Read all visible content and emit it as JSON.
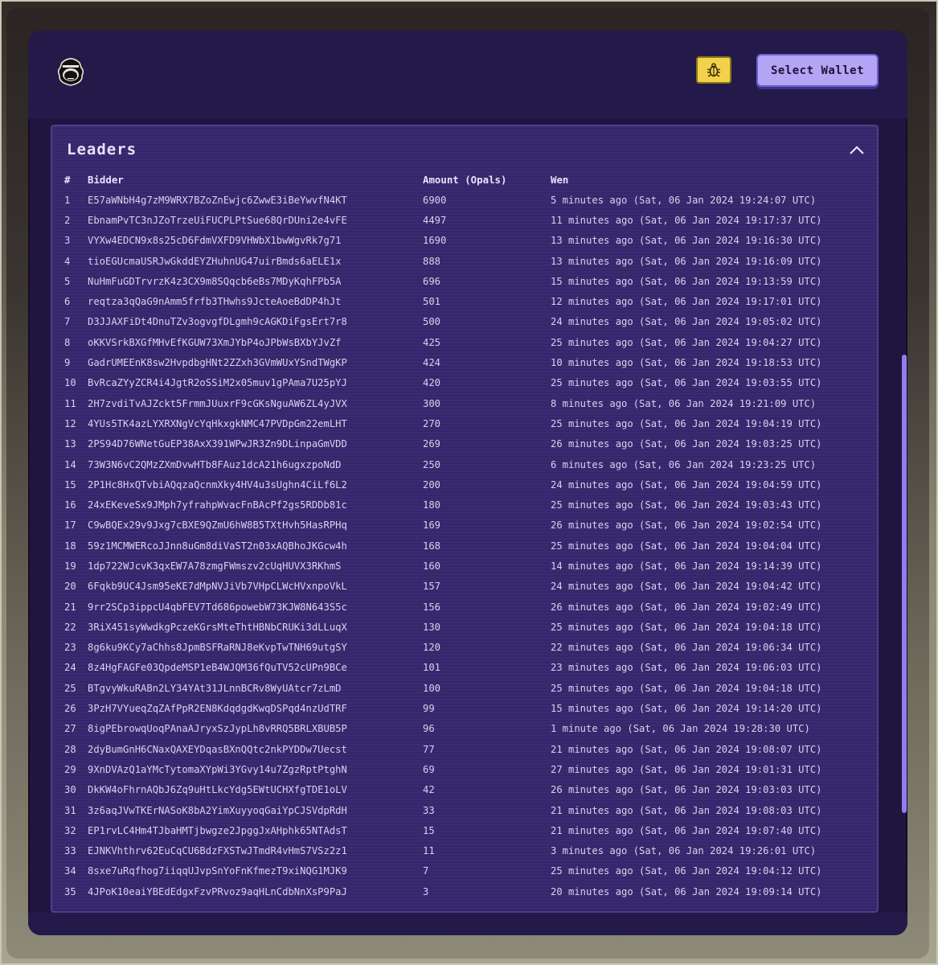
{
  "header": {
    "logo_icon": "gorilla-logo-icon",
    "bug_icon": "bug-icon",
    "wallet_label": "Select Wallet"
  },
  "colors": {
    "background": "#1f1640",
    "panel": "#3b2a72",
    "accent": "#b3a4f5",
    "bug_button": "#f2d24a"
  },
  "leaders": {
    "title": "Leaders",
    "collapse_icon": "chevron-up-icon",
    "columns": [
      "#",
      "Bidder",
      "Amount (Opals)",
      "Wen"
    ],
    "rows": [
      {
        "rank": "1",
        "bidder": "E57aWNbH4g7zM9WRX7BZoZnEwjc6ZwwE3iBeYwvfN4KT",
        "amount": "6900",
        "wen": "5 minutes ago (Sat, 06 Jan 2024 19:24:07 UTC)"
      },
      {
        "rank": "2",
        "bidder": "EbnamPvTC3nJZoTrzeUiFUCPLPtSue68QrDUni2e4vFE",
        "amount": "4497",
        "wen": "11 minutes ago (Sat, 06 Jan 2024 19:17:37 UTC)"
      },
      {
        "rank": "3",
        "bidder": "VYXw4EDCN9x8s25cD6FdmVXFD9VHWbX1bwWgvRk7g71",
        "amount": "1690",
        "wen": "13 minutes ago (Sat, 06 Jan 2024 19:16:30 UTC)"
      },
      {
        "rank": "4",
        "bidder": "tioEGUcmaUSRJwGkddEYZHuhnUG47uirBmds6aELE1x",
        "amount": "888",
        "wen": "13 minutes ago (Sat, 06 Jan 2024 19:16:09 UTC)"
      },
      {
        "rank": "5",
        "bidder": "NuHmFuGDTrvrzK4z3CX9m8SQqcb6eBs7MDyKqhFPb5A",
        "amount": "696",
        "wen": "15 minutes ago (Sat, 06 Jan 2024 19:13:59 UTC)"
      },
      {
        "rank": "6",
        "bidder": "reqtza3qQaG9nAmm5frfb3THwhs9JcteAoeBdDP4hJt",
        "amount": "501",
        "wen": "12 minutes ago (Sat, 06 Jan 2024 19:17:01 UTC)"
      },
      {
        "rank": "7",
        "bidder": "D3JJAXFiDt4DnuTZv3ogvgfDLgmh9cAGKDiFgsErt7r8",
        "amount": "500",
        "wen": "24 minutes ago (Sat, 06 Jan 2024 19:05:02 UTC)"
      },
      {
        "rank": "8",
        "bidder": "oKKVSrkBXGfMHvEfKGUW73XmJYbP4oJPbWsBXbYJvZf",
        "amount": "425",
        "wen": "25 minutes ago (Sat, 06 Jan 2024 19:04:27 UTC)"
      },
      {
        "rank": "9",
        "bidder": "GadrUMEEnK8sw2HvpdbgHNt2ZZxh3GVmWUxYSndTWgKP",
        "amount": "424",
        "wen": "10 minutes ago (Sat, 06 Jan 2024 19:18:53 UTC)"
      },
      {
        "rank": "10",
        "bidder": "BvRcaZYyZCR4i4JgtR2oSSiM2x05muv1gPAma7U25pYJ",
        "amount": "420",
        "wen": "25 minutes ago (Sat, 06 Jan 2024 19:03:55 UTC)"
      },
      {
        "rank": "11",
        "bidder": "2H7zvdiTvAJZckt5FrmmJUuxrF9cGKsNguAW6ZL4yJVX",
        "amount": "300",
        "wen": "8 minutes ago (Sat, 06 Jan 2024 19:21:09 UTC)"
      },
      {
        "rank": "12",
        "bidder": "4YUs5TK4azLYXRXNgVcYqHkxgkNMC47PVDpGm22emLHT",
        "amount": "270",
        "wen": "25 minutes ago (Sat, 06 Jan 2024 19:04:19 UTC)"
      },
      {
        "rank": "13",
        "bidder": "2PS94D76WNetGuEP38AxX391WPwJR3Zn9DLinpaGmVDD",
        "amount": "269",
        "wen": "26 minutes ago (Sat, 06 Jan 2024 19:03:25 UTC)"
      },
      {
        "rank": "14",
        "bidder": "73W3N6vC2QMzZXmDvwHTb8FAuz1dcA21h6ugxzpoNdD",
        "amount": "250",
        "wen": "6 minutes ago (Sat, 06 Jan 2024 19:23:25 UTC)"
      },
      {
        "rank": "15",
        "bidder": "2P1Hc8HxQTvbiAQqzaQcnmXky4HV4u3sUghn4CiLf6L2",
        "amount": "200",
        "wen": "24 minutes ago (Sat, 06 Jan 2024 19:04:59 UTC)"
      },
      {
        "rank": "16",
        "bidder": "24xEKeveSx9JMph7yfrahpWvacFnBAcPf2gs5RDDb81c",
        "amount": "180",
        "wen": "25 minutes ago (Sat, 06 Jan 2024 19:03:43 UTC)"
      },
      {
        "rank": "17",
        "bidder": "C9wBQEx29v9Jxg7cBXE9QZmU6hW8B5TXtHvh5HasRPHq",
        "amount": "169",
        "wen": "26 minutes ago (Sat, 06 Jan 2024 19:02:54 UTC)"
      },
      {
        "rank": "18",
        "bidder": "59z1MCMWERcoJJnn8uGm8diVaST2n03xAQBhoJKGcw4h",
        "amount": "168",
        "wen": "25 minutes ago (Sat, 06 Jan 2024 19:04:04 UTC)"
      },
      {
        "rank": "19",
        "bidder": "1dp722WJcvK3qxEW7A78zmgFWmszv2cUqHUVX3RKhmS",
        "amount": "160",
        "wen": "14 minutes ago (Sat, 06 Jan 2024 19:14:39 UTC)"
      },
      {
        "rank": "20",
        "bidder": "6Fqkb9UC4Jsm95eKE7dMpNVJiVb7VHpCLWcHVxnpoVkL",
        "amount": "157",
        "wen": "24 minutes ago (Sat, 06 Jan 2024 19:04:42 UTC)"
      },
      {
        "rank": "21",
        "bidder": "9rr2SCp3ippcU4qbFEV7Td686powebW73KJW8N643S5c",
        "amount": "156",
        "wen": "26 minutes ago (Sat, 06 Jan 2024 19:02:49 UTC)"
      },
      {
        "rank": "22",
        "bidder": "3RiX451syWwdkgPczeKGrsMteThtHBNbCRUKi3dLLuqX",
        "amount": "130",
        "wen": "25 minutes ago (Sat, 06 Jan 2024 19:04:18 UTC)"
      },
      {
        "rank": "23",
        "bidder": "8g6ku9KCy7aChhs8JpmBSFRaRNJ8eKvpTwTNH69utgSY",
        "amount": "120",
        "wen": "22 minutes ago (Sat, 06 Jan 2024 19:06:34 UTC)"
      },
      {
        "rank": "24",
        "bidder": "8z4HgFAGFe03QpdeMSP1eB4WJQM36fQuTV52cUPn9BCe",
        "amount": "101",
        "wen": "23 minutes ago (Sat, 06 Jan 2024 19:06:03 UTC)"
      },
      {
        "rank": "25",
        "bidder": "BTgvyWkuRABn2LY34YAt31JLnnBCRv8WyUAtcr7zLmD",
        "amount": "100",
        "wen": "25 minutes ago (Sat, 06 Jan 2024 19:04:18 UTC)"
      },
      {
        "rank": "26",
        "bidder": "3PzH7VYueqZqZAfPpR2EN8KdqdgdKwqDSPqd4nzUdTRF",
        "amount": "99",
        "wen": "15 minutes ago (Sat, 06 Jan 2024 19:14:20 UTC)"
      },
      {
        "rank": "27",
        "bidder": "8igPEbrowqUoqPAnaAJryxSzJypLh8vRRQ5BRLXBUB5P",
        "amount": "96",
        "wen": "1 minute ago (Sat, 06 Jan 2024 19:28:30 UTC)"
      },
      {
        "rank": "28",
        "bidder": "2dyBumGnH6CNaxQAXEYDqasBXnQQtc2nkPYDDw7Uecst",
        "amount": "77",
        "wen": "21 minutes ago (Sat, 06 Jan 2024 19:08:07 UTC)"
      },
      {
        "rank": "29",
        "bidder": "9XnDVAzQ1aYMcTytomaXYpWi3YGvy14u7ZgzRptPtghN",
        "amount": "69",
        "wen": "27 minutes ago (Sat, 06 Jan 2024 19:01:31 UTC)"
      },
      {
        "rank": "30",
        "bidder": "DkKW4oFhrnAQbJ6Zq9uHtLkcYdg5EWtUCHXfgTDE1oLV",
        "amount": "42",
        "wen": "26 minutes ago (Sat, 06 Jan 2024 19:03:03 UTC)"
      },
      {
        "rank": "31",
        "bidder": "3z6aqJVwTKErNASoK8bA2YimXuyyoqGaiYpCJSVdpRdH",
        "amount": "33",
        "wen": "21 minutes ago (Sat, 06 Jan 2024 19:08:03 UTC)"
      },
      {
        "rank": "32",
        "bidder": "EP1rvLC4Hm4TJbaHMTjbwgze2JpggJxAHphk65NTAdsT",
        "amount": "15",
        "wen": "21 minutes ago (Sat, 06 Jan 2024 19:07:40 UTC)"
      },
      {
        "rank": "33",
        "bidder": "EJNKVhthrv62EuCqCU6BdzFXSTwJTmdR4vHmS7VSz2z1",
        "amount": "11",
        "wen": "3 minutes ago (Sat, 06 Jan 2024 19:26:01 UTC)"
      },
      {
        "rank": "34",
        "bidder": "8sxe7uRqfhog7iiqqUJvpSnYoFnKfmezT9xiNQG1MJK9",
        "amount": "7",
        "wen": "25 minutes ago (Sat, 06 Jan 2024 19:04:12 UTC)"
      },
      {
        "rank": "35",
        "bidder": "4JPoK10eaiYBEdEdgxFzvPRvoz9aqHLnCdbNnXsP9PaJ",
        "amount": "3",
        "wen": "20 minutes ago (Sat, 06 Jan 2024 19:09:14 UTC)"
      }
    ]
  }
}
